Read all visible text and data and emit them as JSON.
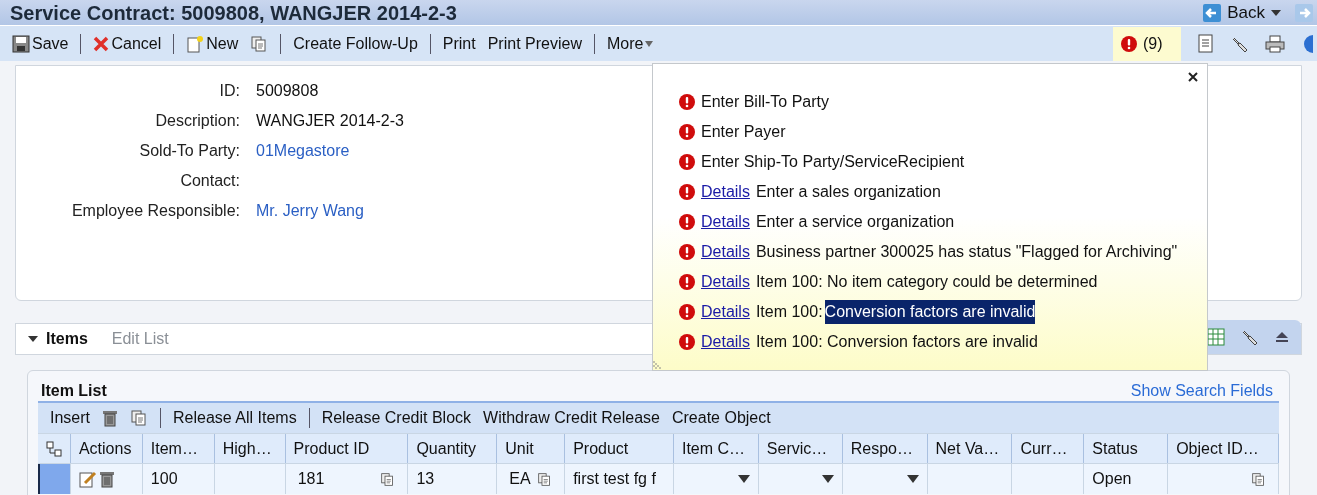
{
  "window": {
    "title": "Service Contract: 5009808, WANGJER 2014-2-3",
    "back": "Back"
  },
  "toolbar": {
    "items": [
      {
        "kind": "save",
        "label": "Save"
      },
      {
        "kind": "cancel",
        "label": "Cancel"
      },
      {
        "kind": "new",
        "label": "New"
      },
      {
        "kind": "copy"
      },
      {
        "kind": "text",
        "label": "Create Follow-Up"
      },
      {
        "kind": "text",
        "label": "Print"
      },
      {
        "kind": "text",
        "label": "Print Preview"
      },
      {
        "kind": "menu",
        "label": "More"
      }
    ],
    "message_count": "(9)"
  },
  "general_data": {
    "fields": [
      {
        "label": "ID:",
        "value": "5009808",
        "kind": "text"
      },
      {
        "label": "Description:",
        "value": "WANGJER 2014-2-3",
        "kind": "text"
      },
      {
        "label": "Sold-To Party:",
        "value": "01Megastore",
        "kind": "link"
      },
      {
        "label": "Contact:"
      },
      {
        "label": "Employee Responsible:",
        "value": "Mr. Jerry Wang",
        "kind": "link"
      }
    ]
  },
  "messages": [
    {
      "text": "Enter Bill-To Party"
    },
    {
      "text": "Enter Payer"
    },
    {
      "text": "Enter Ship-To Party/ServiceRecipient"
    },
    {
      "link": "Details",
      "text": "Enter a sales organization"
    },
    {
      "link": "Details",
      "text": "Enter a service organization"
    },
    {
      "link": "Details",
      "text": "Business partner 300025 has status \"Flagged for Archiving\""
    },
    {
      "link": "Details",
      "text": "Item 100: No item category could be determined"
    },
    {
      "link": "Details",
      "text": "Item 100:",
      "selected_text": "Conversion factors are invalid"
    },
    {
      "link": "Details",
      "text": "Item 100: Conversion factors are invalid"
    }
  ],
  "items_section": {
    "tabs": [
      {
        "label": "Items",
        "selected": true
      },
      {
        "label": "Edit List",
        "selected": false
      }
    ],
    "title": "Item List",
    "search_link": "Show Search Fields",
    "toolbar": [
      {
        "kind": "text",
        "label": "Insert"
      },
      {
        "kind": "delete"
      },
      {
        "kind": "copy"
      },
      {
        "kind": "separator"
      },
      {
        "kind": "text",
        "label": "Release All Items"
      },
      {
        "kind": "separator"
      },
      {
        "kind": "text",
        "label": "Release Credit Block"
      },
      {
        "kind": "text",
        "label": "Withdraw Credit Release"
      },
      {
        "kind": "text",
        "label": "Create Object"
      }
    ],
    "columns": [
      "Actions",
      "Item…",
      "High…",
      "Product ID",
      "Quantity",
      "Unit",
      "Product",
      "Item C…",
      "Servic…",
      "Respo…",
      "Net Va…",
      "Curr…",
      "Status",
      "Object ID…"
    ],
    "rows": [
      {
        "selected": true,
        "cells": [
          {
            "kind": "actions"
          },
          {
            "kind": "text",
            "text": "100"
          },
          {
            "kind": "text"
          },
          {
            "kind": "value_help",
            "text": "181"
          },
          {
            "kind": "text",
            "text": "13"
          },
          {
            "kind": "value_help",
            "text": "EA"
          },
          {
            "kind": "text",
            "text": "first test fg f"
          },
          {
            "kind": "dropdown"
          },
          {
            "kind": "dropdown"
          },
          {
            "kind": "dropdown"
          },
          {
            "kind": "text"
          },
          {
            "kind": "text"
          },
          {
            "kind": "text",
            "text": "Open"
          },
          {
            "kind": "value_help"
          }
        ]
      }
    ]
  }
}
